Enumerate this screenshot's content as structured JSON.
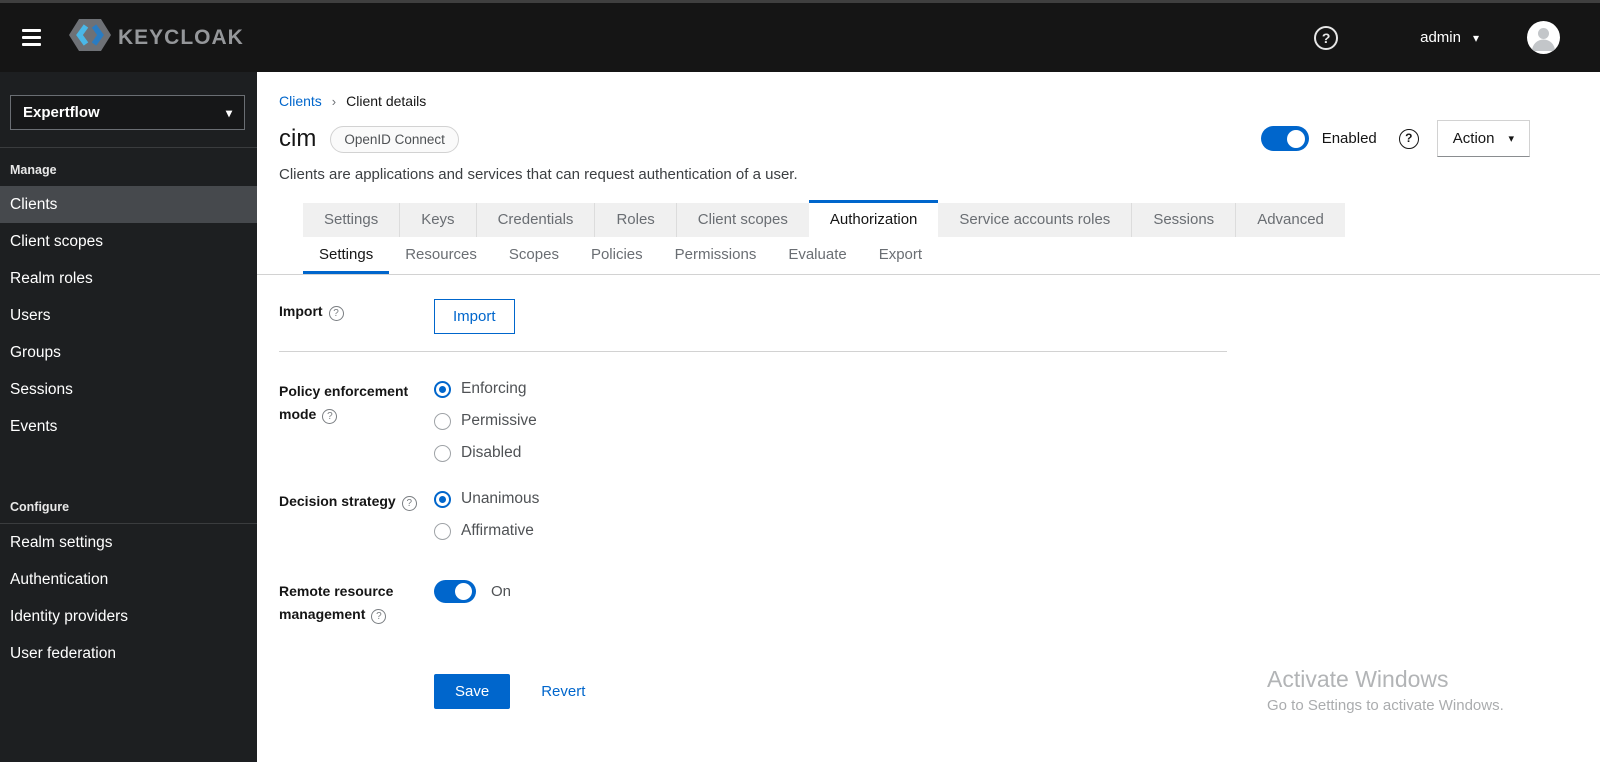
{
  "colors": {
    "accent": "#0066cc",
    "masthead_bg": "#151515",
    "sidebar_bg": "#1d1f21",
    "active_nav_bg": "#46494d"
  },
  "icons": {
    "caret": "▾",
    "question": "?",
    "breadcrumb_separator": "›",
    "hamburger": "menu-icon",
    "brand_mark": "keycloak-hexagon-icon",
    "avatar": "user-avatar-icon"
  },
  "masthead": {
    "brand": "KEYCLOAK",
    "username": "admin"
  },
  "sidebar": {
    "realm": "Expertflow",
    "sections": [
      {
        "label": "Manage",
        "items": [
          "Clients",
          "Client scopes",
          "Realm roles",
          "Users",
          "Groups",
          "Sessions",
          "Events"
        ],
        "active_item": "Clients"
      },
      {
        "label": "Configure",
        "items": [
          "Realm settings",
          "Authentication",
          "Identity providers",
          "User federation"
        ]
      }
    ]
  },
  "breadcrumb": {
    "link": "Clients",
    "current": "Client details"
  },
  "page": {
    "title": "cim",
    "badge": "OpenID Connect",
    "description": "Clients are applications and services that can request authentication of a user.",
    "enabled_label": "Enabled",
    "action_label": "Action"
  },
  "tabs": {
    "items": [
      "Settings",
      "Keys",
      "Credentials",
      "Roles",
      "Client scopes",
      "Authorization",
      "Service accounts roles",
      "Sessions",
      "Advanced"
    ],
    "active": "Authorization"
  },
  "subtabs": {
    "items": [
      "Settings",
      "Resources",
      "Scopes",
      "Policies",
      "Permissions",
      "Evaluate",
      "Export"
    ],
    "active": "Settings"
  },
  "form": {
    "import": {
      "label": "Import",
      "button_label": "Import"
    },
    "policy_enforcement": {
      "label": "Policy enforcement mode",
      "options": [
        "Enforcing",
        "Permissive",
        "Disabled"
      ],
      "selected": "Enforcing"
    },
    "decision_strategy": {
      "label": "Decision strategy",
      "options": [
        "Unanimous",
        "Affirmative"
      ],
      "selected": "Unanimous"
    },
    "remote_resource": {
      "label": "Remote resource management",
      "state_label": "On",
      "enabled": true
    },
    "save_label": "Save",
    "revert_label": "Revert"
  },
  "watermark": {
    "line1": "Activate Windows",
    "line2": "Go to Settings to activate Windows."
  }
}
